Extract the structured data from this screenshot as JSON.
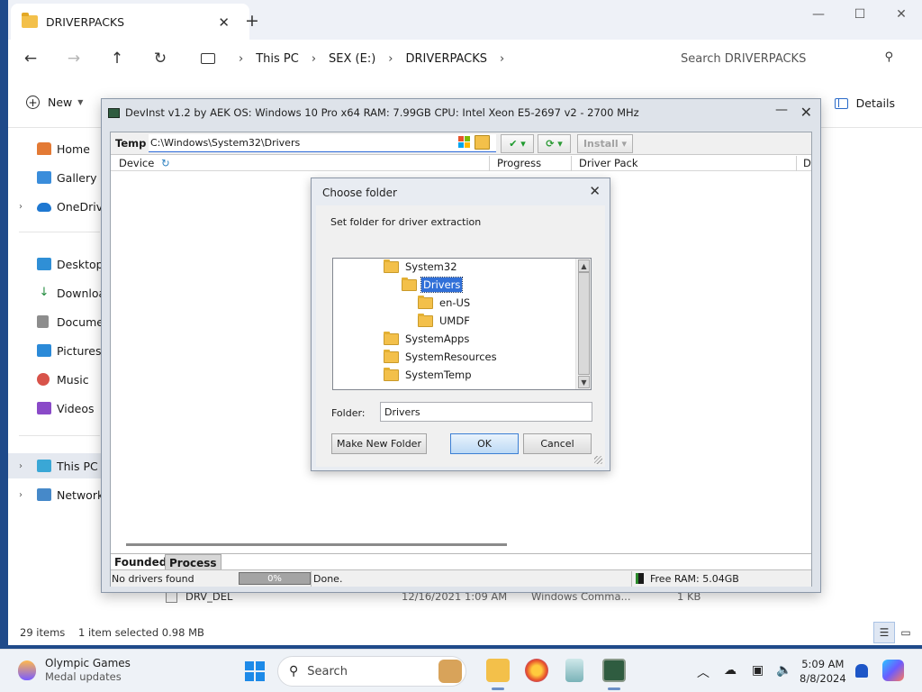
{
  "explorer": {
    "tab_title": "DRIVERPACKS",
    "breadcrumb": [
      "This PC",
      "SEX (E:)",
      "DRIVERPACKS"
    ],
    "search_placeholder": "Search DRIVERPACKS",
    "new_label": "New",
    "details_label": "Details",
    "sidebar": [
      {
        "label": "Home",
        "icon": "home-icon"
      },
      {
        "label": "Gallery",
        "icon": "gallery-icon"
      },
      {
        "label": "OneDrive",
        "icon": "cloud-icon"
      },
      {
        "label": "Desktop",
        "icon": "desktop-icon"
      },
      {
        "label": "Downloads",
        "icon": "download-icon"
      },
      {
        "label": "Documents",
        "icon": "document-icon"
      },
      {
        "label": "Pictures",
        "icon": "pictures-icon"
      },
      {
        "label": "Music",
        "icon": "music-icon"
      },
      {
        "label": "Videos",
        "icon": "videos-icon"
      },
      {
        "label": "This PC",
        "icon": "computer-icon"
      },
      {
        "label": "Network",
        "icon": "network-icon"
      }
    ],
    "files": [
      {
        "name": "DRV_DEL",
        "date": "12/16/2021 1:09 AM",
        "type": "Windows Comma...",
        "size": "1 KB"
      }
    ],
    "status": {
      "count": "29 items",
      "selection": "1 item selected  0.98 MB"
    }
  },
  "devinst": {
    "title": "DevInst  v1.2  by  AEK    OS: Windows 10 Pro  x64  RAM: 7.99GB   CPU: Intel Xeon E5-2697 v2 - 2700 MHz",
    "temp_label": "Temp",
    "temp_path": "C:\\Windows\\System32\\Drivers",
    "install_label": "Install",
    "columns": [
      "Device",
      "Progress",
      "Driver Pack",
      "D"
    ],
    "tabs": [
      "Founded",
      "Process"
    ],
    "status": {
      "drivers": "No drivers found",
      "progress": "0%",
      "progress_value": 0,
      "state": "Done.",
      "ram": "Free RAM: 5.04GB"
    }
  },
  "dialog": {
    "title": "Choose folder",
    "description": "Set folder for driver extraction",
    "tree": [
      {
        "label": "System32",
        "level": 0
      },
      {
        "label": "Drivers",
        "level": 1,
        "selected": true
      },
      {
        "label": "en-US",
        "level": 2
      },
      {
        "label": "UMDF",
        "level": 2
      },
      {
        "label": "SystemApps",
        "level": 0
      },
      {
        "label": "SystemResources",
        "level": 0
      },
      {
        "label": "SystemTemp",
        "level": 0
      }
    ],
    "folder_label": "Folder:",
    "folder_value": "Drivers",
    "buttons": {
      "make_new": "Make New Folder",
      "ok": "OK",
      "cancel": "Cancel"
    }
  },
  "taskbar": {
    "news_title": "Olympic Games",
    "news_subtitle": "Medal updates",
    "search_placeholder": "Search",
    "time": "5:09 AM",
    "date": "8/8/2024"
  },
  "colors": {
    "accent": "#3170d8",
    "folder": "#f3c04a",
    "selection": "#e5e9f0"
  }
}
